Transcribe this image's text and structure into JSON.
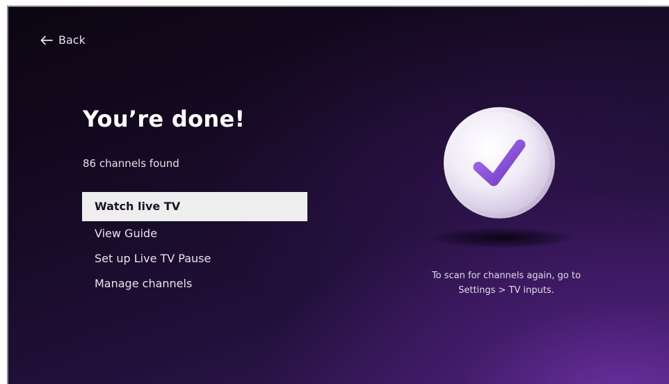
{
  "nav": {
    "back_label": "Back"
  },
  "main": {
    "title": "You’re done!",
    "subtitle": "86 channels found",
    "menu": [
      {
        "label": "Watch live TV",
        "selected": true
      },
      {
        "label": "View Guide",
        "selected": false
      },
      {
        "label": "Set up Live TV Pause",
        "selected": false
      },
      {
        "label": "Manage channels",
        "selected": false
      }
    ]
  },
  "illustration": {
    "icon": "checkmark-icon",
    "accent": "#8a52d6"
  },
  "hint": {
    "line1": "To scan for channels again, go to",
    "line2": "Settings > TV inputs."
  }
}
